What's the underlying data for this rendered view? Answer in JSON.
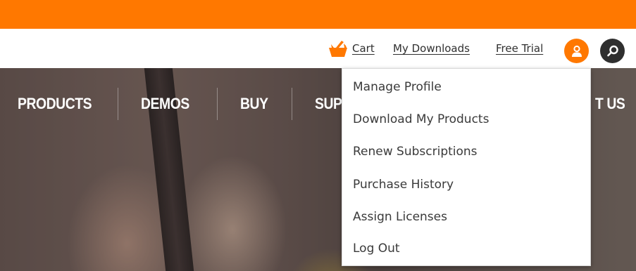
{
  "utility_links": {
    "cart": "Cart",
    "downloads": "My Downloads",
    "trial": "Free Trial"
  },
  "icons": {
    "cart": "shopping-basket-icon",
    "profile": "user-icon",
    "search": "magnifier-icon"
  },
  "nav": {
    "items": [
      {
        "label": "PRODUCTS"
      },
      {
        "label": "DEMOS"
      },
      {
        "label": "BUY"
      },
      {
        "label": "SUP"
      },
      {
        "label": "T US"
      }
    ]
  },
  "profile_menu": {
    "items": [
      {
        "label": "Manage Profile"
      },
      {
        "label": "Download My Products"
      },
      {
        "label": "Renew Subscriptions"
      },
      {
        "label": "Purchase History"
      },
      {
        "label": "Assign Licenses"
      },
      {
        "label": "Log Out"
      }
    ]
  },
  "colors": {
    "brand_orange": "#ff7800",
    "dark": "#2f2f2f",
    "text": "#3a3a3a",
    "white": "#ffffff"
  }
}
